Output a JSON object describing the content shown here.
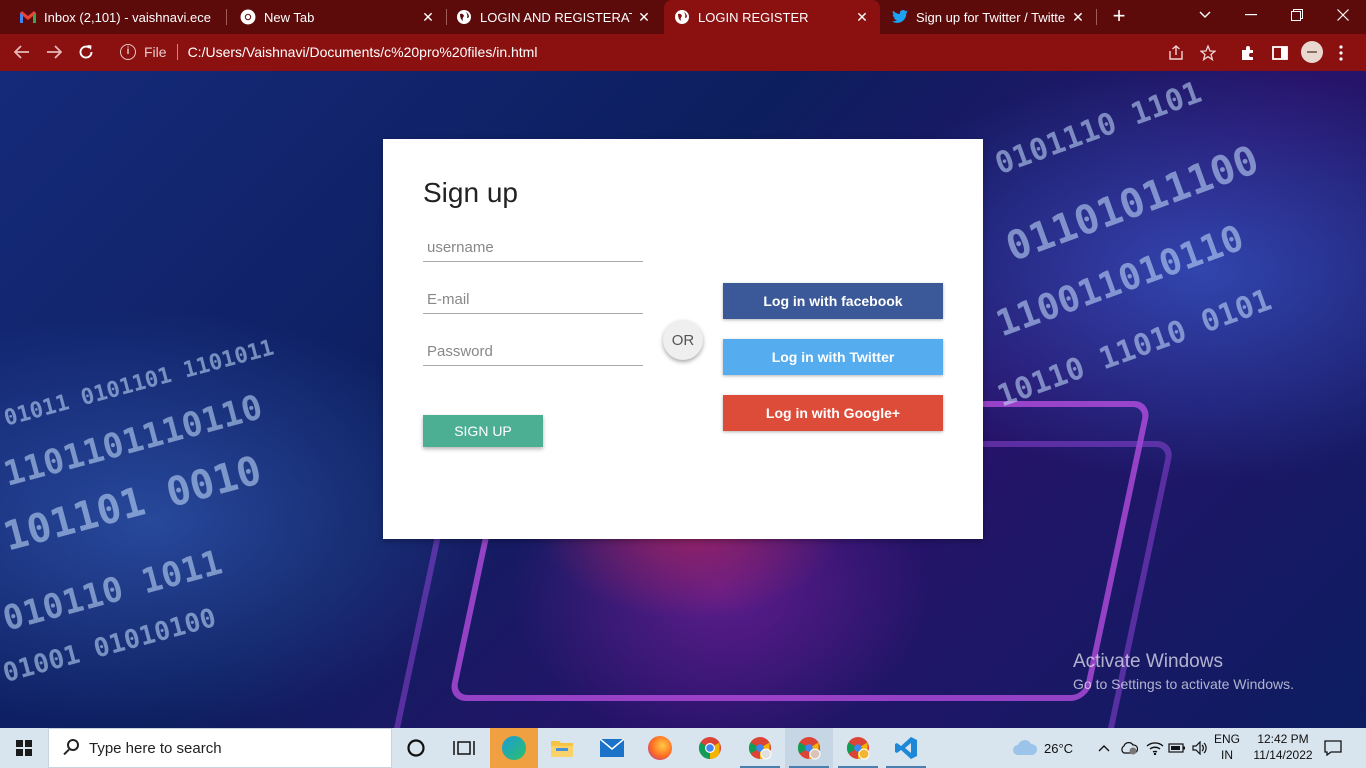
{
  "browser": {
    "tabs": [
      {
        "title": "Inbox (2,101) - vaishnavi.ece",
        "icon": "gmail-icon",
        "active": false
      },
      {
        "title": "New Tab",
        "icon": "chrome-icon",
        "active": false
      },
      {
        "title": "LOGIN AND REGISTERATION",
        "icon": "globe-icon",
        "active": false
      },
      {
        "title": "LOGIN REGISTER",
        "icon": "globe-icon",
        "active": true
      },
      {
        "title": "Sign up for Twitter / Twitter",
        "icon": "twitter-icon",
        "active": false
      }
    ],
    "address": {
      "scheme_label": "File",
      "url": "C:/Users/Vaishnavi/Documents/c%20pro%20files/in.html"
    }
  },
  "form": {
    "title": "Sign up",
    "username_placeholder": "username",
    "email_placeholder": "E-mail",
    "password_placeholder": "Password",
    "submit_label": "SIGN UP",
    "or_label": "OR"
  },
  "social": {
    "facebook_label": "Log in with facebook",
    "twitter_label": "Log in with Twitter",
    "google_label": "Log in with Google+"
  },
  "colors": {
    "facebook": "#3b5998",
    "twitter": "#55acee",
    "google": "#dd4b39",
    "signup": "#4caf93",
    "browser_frame": "#8b1010"
  },
  "watermark": {
    "line1": "Activate Windows",
    "line2": "Go to Settings to activate Windows."
  },
  "taskbar": {
    "search_placeholder": "Type here to search",
    "weather": "26°C",
    "lang_line1": "ENG",
    "lang_line2": "IN",
    "time": "12:42 PM",
    "date": "11/14/2022"
  }
}
